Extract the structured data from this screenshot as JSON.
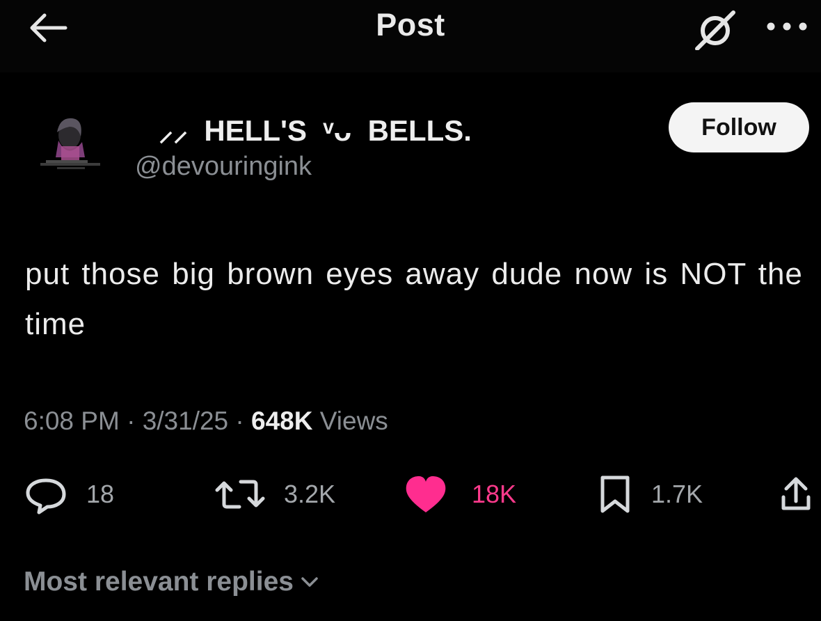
{
  "header": {
    "title": "Post",
    "back_icon": "arrow-left-icon",
    "grok_icon": "grok-icon",
    "more_icon": "more-horizontal-icon"
  },
  "author": {
    "display_name": "⸝⸝  HELL'S  ᵛᴗ  BELLS.",
    "handle": "@devouringink",
    "follow_label": "Follow"
  },
  "post": {
    "text": "put those big brown eyes away dude now is NOT the time",
    "time": "6:08 PM",
    "date": "3/31/25",
    "views_count": "648K",
    "views_label": "Views"
  },
  "actions": {
    "replies": "18",
    "reposts": "3.2K",
    "likes": "18K",
    "bookmarks": "1.7K"
  },
  "colors": {
    "background": "#000000",
    "like_accent": "#ff3a8c",
    "muted_text": "#8b8f94"
  },
  "replies": {
    "sort_label": "Most relevant replies"
  }
}
